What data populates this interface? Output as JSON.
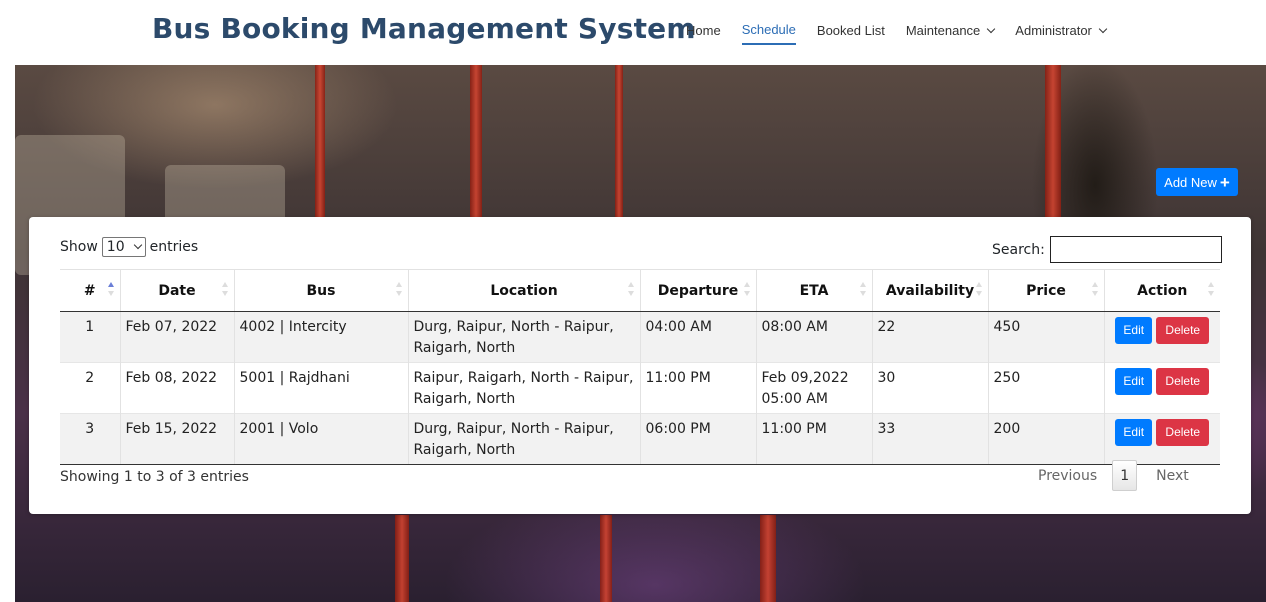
{
  "header": {
    "brand": "Bus Booking Management System",
    "nav": {
      "home": "Home",
      "schedule": "Schedule",
      "booked_list": "Booked List",
      "maintenance": "Maintenance",
      "administrator": "Administrator"
    },
    "active_nav": "Schedule"
  },
  "add_new_label": "Add New",
  "table_controls": {
    "show_label": "Show",
    "entries_value": "10",
    "entries_label": "entries",
    "search_label": "Search:",
    "search_value": ""
  },
  "columns": [
    "#",
    "Date",
    "Bus",
    "Location",
    "Departure",
    "ETA",
    "Availability",
    "Price",
    "Action"
  ],
  "rows": [
    {
      "num": "1",
      "date": "Feb 07, 2022",
      "bus": "4002 | Intercity",
      "location": "Durg, Raipur, North - Raipur, Raigarh, North",
      "departure": "04:00 AM",
      "eta": "08:00 AM",
      "availability": "22",
      "price": "450"
    },
    {
      "num": "2",
      "date": "Feb 08, 2022",
      "bus": "5001 | Rajdhani",
      "location": "Raipur, Raigarh, North - Raipur, Raigarh, North",
      "departure": "11:00 PM",
      "eta": "Feb 09,2022 05:00 AM",
      "availability": "30",
      "price": "250"
    },
    {
      "num": "3",
      "date": "Feb 15, 2022",
      "bus": "2001 | Volo",
      "location": "Durg, Raipur, North - Raipur, Raigarh, North",
      "departure": "06:00 PM",
      "eta": "11:00 PM",
      "availability": "33",
      "price": "200"
    }
  ],
  "row_actions": {
    "edit": "Edit",
    "delete": "Delete"
  },
  "footer": {
    "info": "Showing 1 to 3 of 3 entries",
    "previous": "Previous",
    "current_page": "1",
    "next": "Next"
  },
  "colors": {
    "brand": "#2c4a6b",
    "primary": "#007bff",
    "danger": "#dc3545",
    "active_nav": "#2c6db5"
  }
}
